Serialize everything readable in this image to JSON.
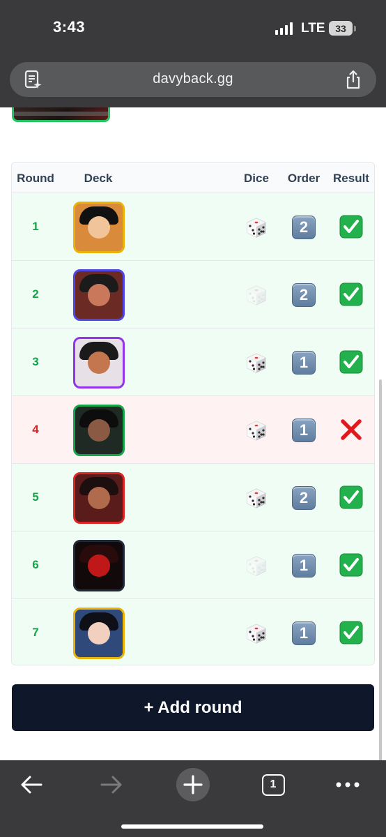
{
  "status_bar": {
    "time": "3:43",
    "network": "LTE",
    "battery": "33"
  },
  "browser": {
    "url": "davyback.gg"
  },
  "table": {
    "headers": {
      "round": "Round",
      "deck": "Deck",
      "dice": "Dice",
      "order": "Order",
      "result": "Result"
    },
    "rows": [
      {
        "round": "1",
        "order": "2",
        "dice": "dark",
        "result": "win",
        "deck_border": "#eab308",
        "deck_bg": "#d98a3a",
        "deck_hair": "#111111",
        "deck_face": "#f1c49a"
      },
      {
        "round": "2",
        "order": "2",
        "dice": "faded",
        "result": "win",
        "deck_border": "#4f46e5",
        "deck_bg": "#6b2b24",
        "deck_hair": "#1b1b1b",
        "deck_face": "#c9785c"
      },
      {
        "round": "3",
        "order": "1",
        "dice": "dark",
        "result": "win",
        "deck_border": "#9333ea",
        "deck_bg": "#e7e0e6",
        "deck_hair": "#1a1a1a",
        "deck_face": "#c4764f"
      },
      {
        "round": "4",
        "order": "1",
        "dice": "dark",
        "result": "loss",
        "deck_border": "#16a34a",
        "deck_bg": "#1f2a24",
        "deck_hair": "#0d0d0d",
        "deck_face": "#8a5a45"
      },
      {
        "round": "5",
        "order": "2",
        "dice": "dark",
        "result": "win",
        "deck_border": "#dc2626",
        "deck_bg": "#5a1b1b",
        "deck_hair": "#1d0f0f",
        "deck_face": "#b06a4c"
      },
      {
        "round": "6",
        "order": "1",
        "dice": "faded",
        "result": "win",
        "deck_border": "#1f2937",
        "deck_bg": "#120a0a",
        "deck_hair": "#2a0b0b",
        "deck_face": "#c01818"
      },
      {
        "round": "7",
        "order": "1",
        "dice": "dark",
        "result": "win",
        "deck_border": "#eab308",
        "deck_bg": "#2f4a7a",
        "deck_hair": "#0f0f18",
        "deck_face": "#f2d0bf"
      }
    ]
  },
  "add_round_label": "+ Add round",
  "toolbar": {
    "tabs_count": "1"
  },
  "colors": {
    "win_bg": "#f0fdf4",
    "loss_bg": "#fef2f2",
    "win_text": "#16a34a",
    "loss_text": "#dc2626",
    "button": "#0f172a"
  }
}
